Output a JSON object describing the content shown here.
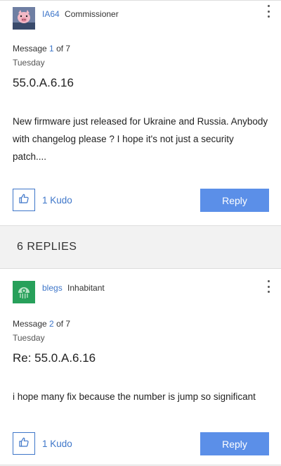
{
  "posts": [
    {
      "author": "IA64",
      "rank": "Commissioner",
      "message_prefix": "Message",
      "message_num": "1",
      "message_total": "of 7",
      "day": "Tuesday",
      "subject": "55.0.A.6.16",
      "body": "New firmware just released for Ukraine and Russia. Anybody with changelog please ? I hope it's not just a security patch....",
      "kudo_label": "1 Kudo",
      "reply_label": "Reply"
    },
    {
      "author": "blegs",
      "rank": "Inhabitant",
      "message_prefix": "Message",
      "message_num": "2",
      "message_total": "of 7",
      "day": "Tuesday",
      "subject": "Re: 55.0.A.6.16",
      "body": "i hope many fix because the number is jump so significant",
      "kudo_label": "1 Kudo",
      "reply_label": "Reply"
    }
  ],
  "replies_header": "6 REPLIES",
  "colors": {
    "link": "#3e76c9",
    "button": "#5b8fe8",
    "background": "#f2f2f2"
  },
  "icons": {
    "thumb": "thumbs-up-icon",
    "menu": "more-options-icon"
  }
}
